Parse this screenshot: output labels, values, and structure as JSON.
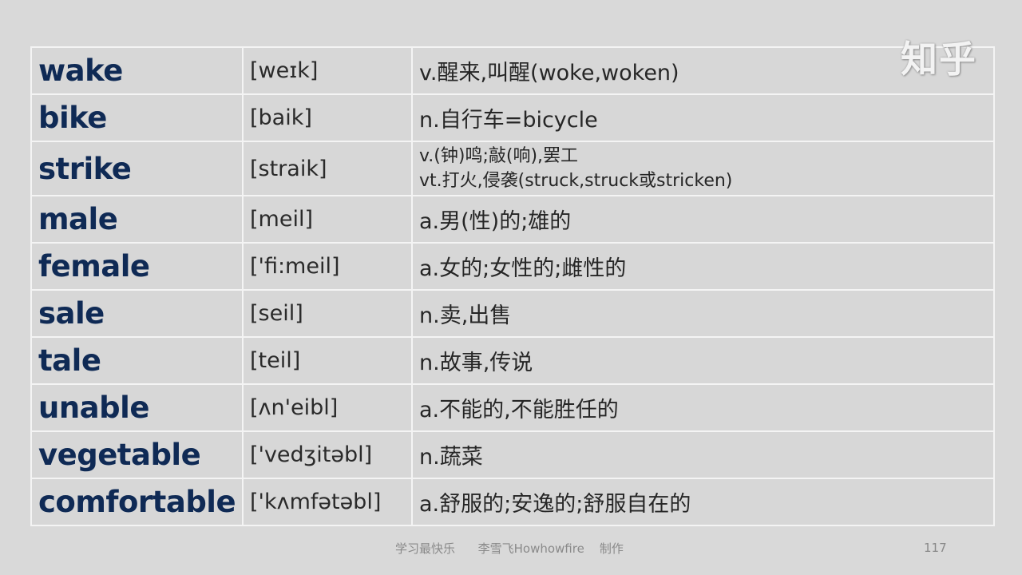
{
  "watermark": "知乎",
  "rows": [
    {
      "word": "wake",
      "phonetic": "[weɪk]",
      "meaning": [
        "v.醒来,叫醒(woke,woken)"
      ]
    },
    {
      "word": "bike",
      "phonetic": "[baik]",
      "meaning": [
        "n.自行车=bicycle"
      ]
    },
    {
      "word": "strike",
      "phonetic": "[straik]",
      "meaning": [
        "v.(钟)鸣;敲(响),罢工",
        "vt.打火,侵袭(struck,struck或stricken)"
      ]
    },
    {
      "word": "male",
      "phonetic": "[meil]",
      "meaning": [
        "a.男(性)的;雄的"
      ]
    },
    {
      "word": "female",
      "phonetic": "['fi:meil]",
      "meaning": [
        "a.女的;女性的;雌性的"
      ]
    },
    {
      "word": "sale",
      "phonetic": "[seil]",
      "meaning": [
        "n.卖,出售"
      ]
    },
    {
      "word": "tale",
      "phonetic": "[teil]",
      "meaning": [
        "n.故事,传说"
      ]
    },
    {
      "word": "unable",
      "phonetic": "[ʌn'eibl]",
      "meaning": [
        "a.不能的,不能胜任的"
      ]
    },
    {
      "word": "vegetable",
      "phonetic": "['vedʒitəbl]",
      "meaning": [
        "n.蔬菜"
      ]
    },
    {
      "word": "comfortable",
      "phonetic": "['kʌmfətəbl]",
      "meaning": [
        "a.舒服的;安逸的;舒服自在的"
      ]
    }
  ],
  "footer": {
    "credit": "学习最快乐      李雪飞Howhowfire    制作",
    "page_number": "117"
  },
  "colors": {
    "background": "#d9d9d9",
    "word_text": "#0f2a55",
    "grid_line": "#f4f4f4"
  }
}
